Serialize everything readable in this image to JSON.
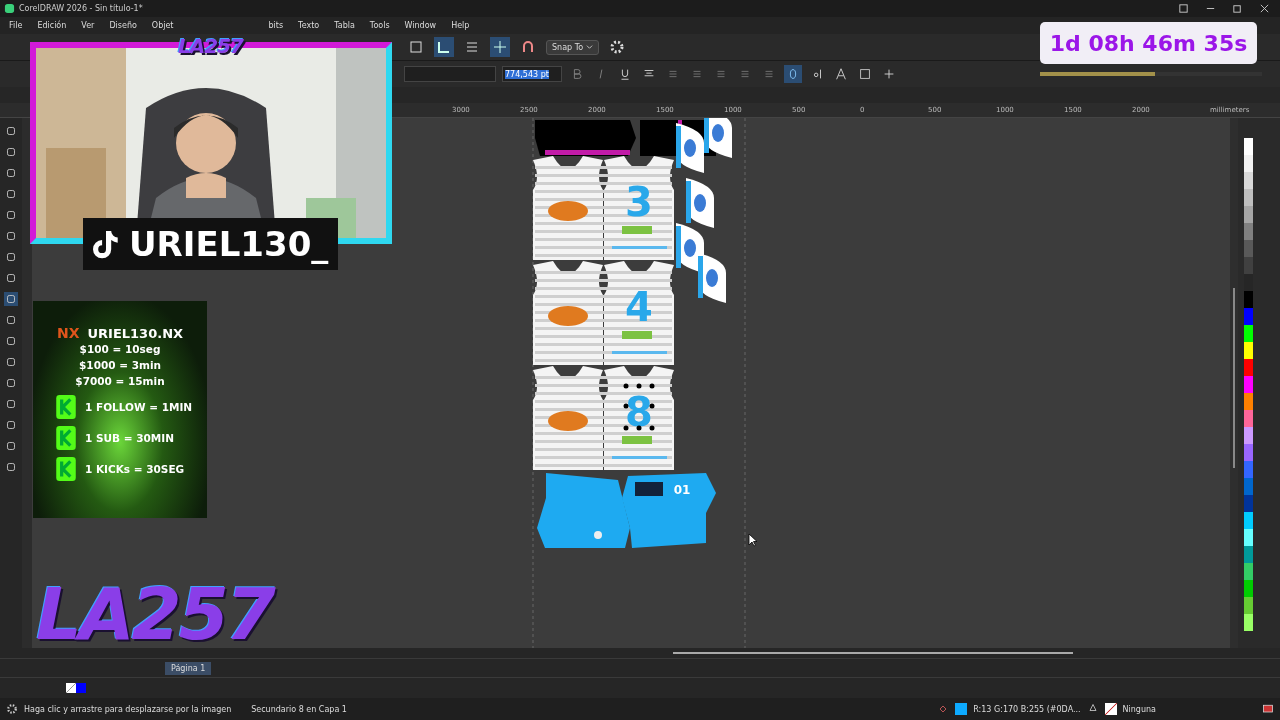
{
  "window": {
    "title": "CorelDRAW 2026 - Sin título-1*"
  },
  "menu": [
    "File",
    "Edición",
    "Ver",
    "Diseño",
    "Objet",
    "bits",
    "Texto",
    "Tabla",
    "Tools",
    "Window",
    "Help"
  ],
  "toolbar": {
    "snap": "Snap To"
  },
  "property_bar": {
    "font_size": "774,543 pt"
  },
  "ruler": {
    "ticks": [
      "3000",
      "2500",
      "2000",
      "1500",
      "1000",
      "500",
      "0",
      "500",
      "1000",
      "1500",
      "2000"
    ],
    "unit": "millimeters"
  },
  "canvas": {
    "jerseys": [
      {
        "number": "3",
        "selected": false
      },
      {
        "number": "4",
        "selected": false
      },
      {
        "number": "8",
        "selected": true
      }
    ],
    "shorts_number": "01"
  },
  "page_tab": "Página 1",
  "status_bar": {
    "hint": "Haga clic y arrastre para desplazarse por la imagen",
    "selection": "Secundario 8 en Capa 1",
    "fill": "R:13 G:170 B:255 (#0DA...",
    "outline": "Ninguna"
  },
  "overlay": {
    "logo_top": "LA257",
    "logo_bottom": "LA257",
    "tiktok": "URIEL130_",
    "donations": {
      "brand": "NX",
      "title": "URIEL130.NX",
      "lines": [
        "$100 = 10seg",
        "$1000 = 3min",
        "$7000 = 15min"
      ],
      "kicks": [
        "1 FOLLOW = 1MIN",
        "1 SUB =  30MIN",
        "1 KICKs = 30SEG"
      ]
    },
    "timer": {
      "text": "1d 08h 46m 35s",
      "level": 0.52
    }
  }
}
